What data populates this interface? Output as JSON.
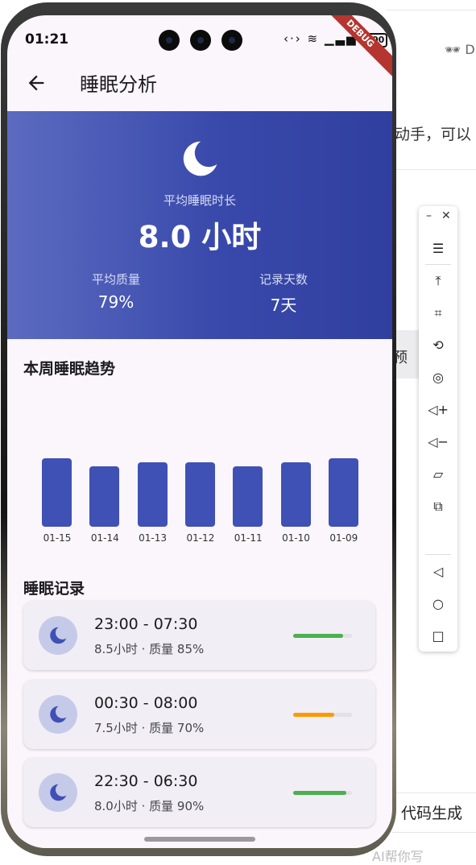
{
  "background": {
    "header_fragment": "D",
    "text_fragment": "动手，可以",
    "chip_fragment": "预",
    "code_button": "代码生成",
    "bottom_fragment": "AI帮你写"
  },
  "status_bar": {
    "time": "01:21",
    "battery": "100",
    "debug_label": "DEBUG"
  },
  "app_bar": {
    "title": "睡眠分析",
    "back_icon": "arrow-back-icon"
  },
  "summary": {
    "icon": "moon-icon",
    "avg_duration_label": "平均睡眠时长",
    "avg_duration_value": "8.0 小时",
    "avg_quality_label": "平均质量",
    "avg_quality_value": "79%",
    "record_days_label": "记录天数",
    "record_days_value": "7天"
  },
  "trend": {
    "title": "本周睡眠趋势",
    "chart_data": {
      "type": "bar",
      "categories": [
        "01-15",
        "01-14",
        "01-13",
        "01-12",
        "01-11",
        "01-10",
        "01-09"
      ],
      "values": [
        8.5,
        7.5,
        8.0,
        8.0,
        7.5,
        8.0,
        8.5
      ],
      "title": "本周睡眠趋势",
      "color": "#3f51b5"
    }
  },
  "records": {
    "title": "睡眠记录",
    "items": [
      {
        "time": "23:00 - 07:30",
        "meta": "8.5小时 · 质量 85%",
        "quality": 0.85,
        "color": "#4caf50"
      },
      {
        "time": "00:30 - 08:00",
        "meta": "7.5小时 · 质量 70%",
        "quality": 0.7,
        "color": "#ff9800"
      },
      {
        "time": "22:30 - 06:30",
        "meta": "8.0小时 · 质量 90%",
        "quality": 0.9,
        "color": "#4caf50"
      }
    ]
  },
  "toolbar": {
    "min_label": "–",
    "close_label": "✕",
    "buttons": [
      "menu-icon",
      "pin-top-icon",
      "crop-icon",
      "rotate-icon",
      "screenshot-icon",
      "volume-up-icon",
      "volume-down-icon",
      "shake-icon",
      "multi-window-icon",
      "back-nav-icon",
      "home-nav-icon",
      "recents-nav-icon"
    ]
  }
}
